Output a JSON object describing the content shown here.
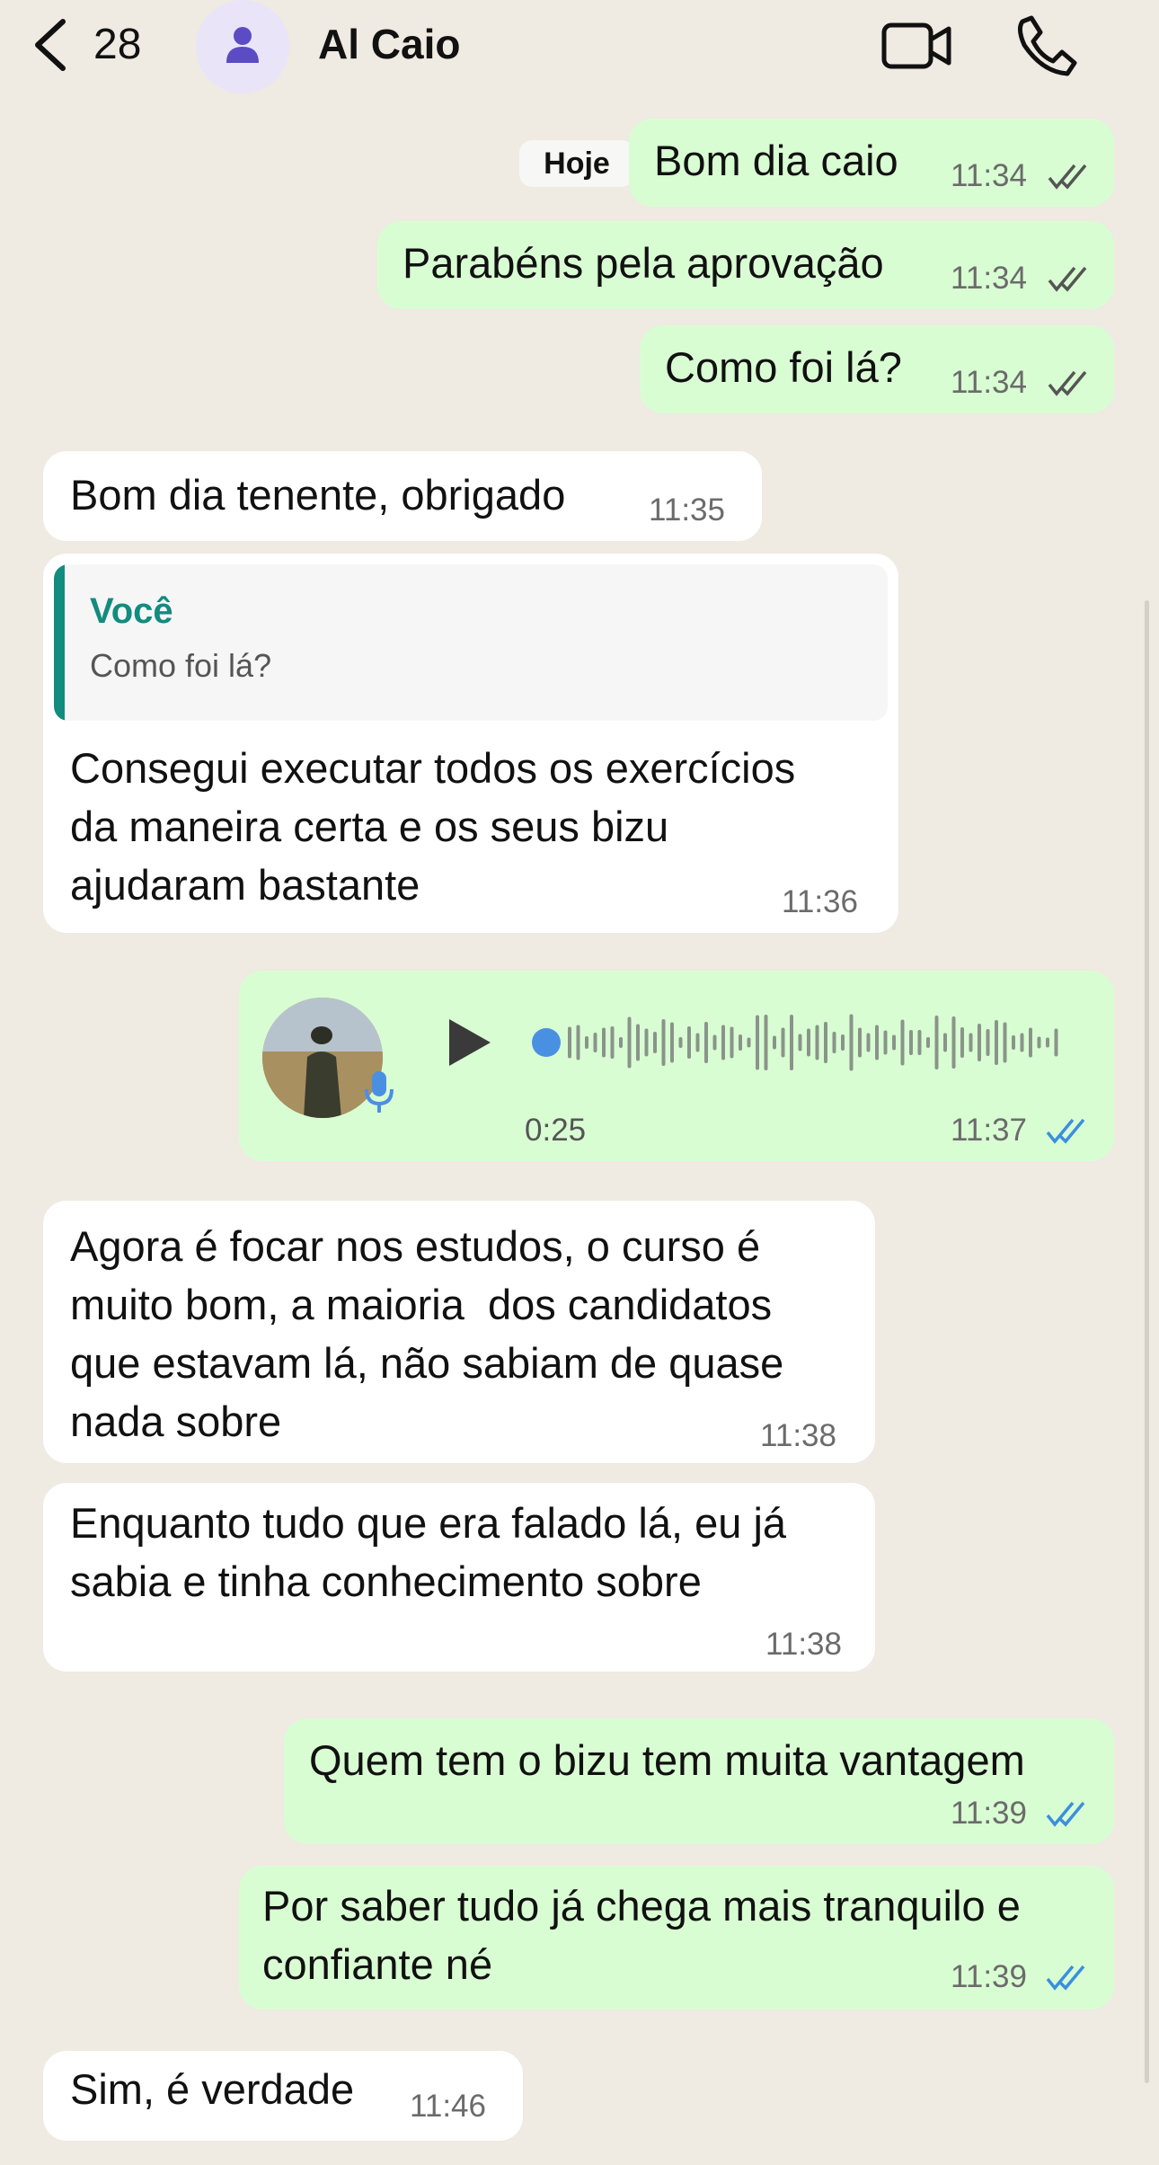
{
  "header": {
    "back_count": "28",
    "contact_name": "Al Caio"
  },
  "date_chip": "Hoje",
  "messages": [
    {
      "text": "Bom dia caio",
      "time": "11:34"
    },
    {
      "text": "Parabéns pela aprovação",
      "time": "11:34"
    },
    {
      "text": "Como foi lá?",
      "time": "11:34"
    },
    {
      "text": "Bom dia tenente, obrigado",
      "time": "11:35"
    },
    {
      "reply_name": "Você",
      "reply_text": "Como foi lá?",
      "text": "Consegui executar todos os exercícios\nda maneira certa e os seus bizu\najudaram bastante",
      "time": "11:36"
    },
    {
      "voice_duration": "0:25",
      "time": "11:37"
    },
    {
      "text": "Agora é focar nos estudos, o curso é\nmuito bom, a maioria  dos candidatos\nque estavam lá, não sabiam de quase\nnada sobre",
      "time": "11:38"
    },
    {
      "text": "Enquanto tudo que era falado lá, eu já\nsabia e tinha conhecimento sobre",
      "time": "11:38"
    },
    {
      "text": "Quem tem o bizu tem muita vantagem",
      "time": "11:39"
    },
    {
      "text": "Por saber tudo já chega mais tranquilo e\nconfiante né",
      "time": "11:39"
    },
    {
      "text": "Sim, é verdade",
      "time": "11:46"
    }
  ],
  "colors": {
    "background": "#efeae2",
    "outgoing_bubble": "#d9fdd3",
    "incoming_bubble": "#ffffff",
    "read_tick_blue": "#3b8fe0",
    "accent_teal": "#128c7e"
  },
  "icons": [
    "chevron-left-icon",
    "person-icon",
    "video-camera-icon",
    "phone-icon",
    "play-icon",
    "microphone-icon",
    "double-check-icon"
  ]
}
